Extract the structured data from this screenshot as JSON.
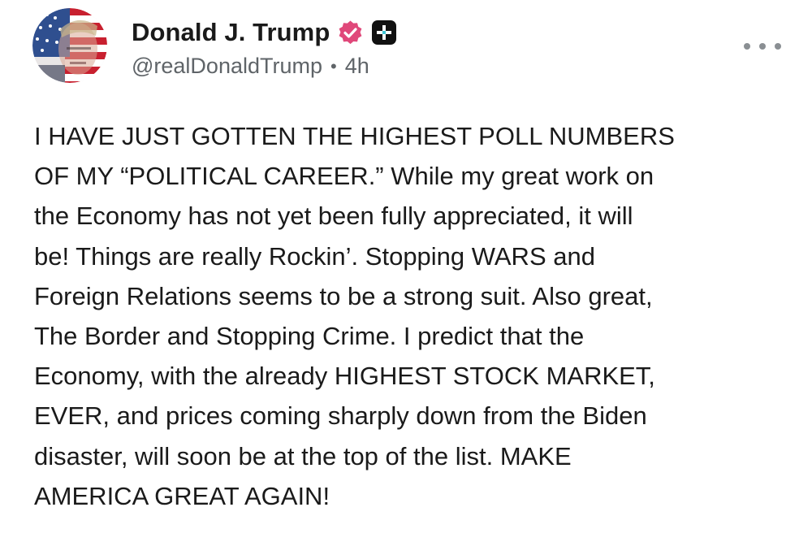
{
  "post": {
    "author": {
      "display_name": "Donald J. Trump",
      "handle": "@realDonaldTrump",
      "verified_icon": "verified-check-icon",
      "plus_badge_icon": "plus-badge-icon",
      "avatar_icon": "avatar-image"
    },
    "separator": "•",
    "timestamp": "4h",
    "more_icon": "ellipsis-icon",
    "text": "I HAVE JUST GOTTEN THE HIGHEST POLL NUMBERS\nOF MY “POLITICAL CAREER.” While my great work on\nthe Economy has not yet been fully appreciated, it will\nbe! Things are really Rockin’. Stopping WARS and\nForeign Relations seems to be a strong suit. Also great,\nThe Border and Stopping Crime. I predict that the\nEconomy, with the already HIGHEST STOCK MARKET,\nEVER, and prices coming sharply down from the Biden\ndisaster, will soon be at the top of the list. MAKE\nAMERICA GREAT AGAIN!"
  },
  "colors": {
    "verified_badge": "#e0487a",
    "plus_badge": "#111111",
    "plus_badge_accent": "#3ec6d6",
    "text_primary": "#1a1a1a",
    "text_secondary": "#5f6468",
    "background": "#ffffff"
  }
}
